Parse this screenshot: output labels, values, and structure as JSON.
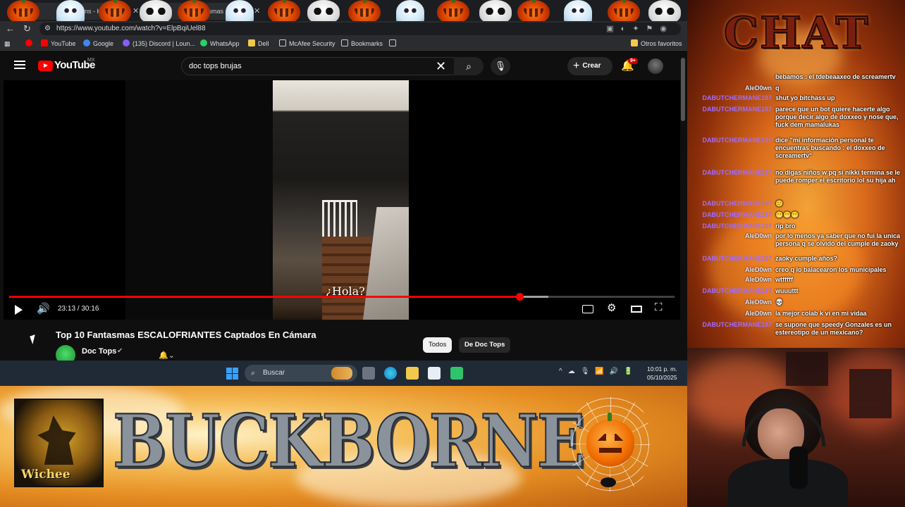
{
  "browser": {
    "tabs": [
      {
        "title": "(103) Ins - KB - M"
      },
      {
        "title": "(10) Fantasmas"
      }
    ],
    "url": "https://www.youtube.com/watch?v=ElpBqiUel88",
    "bookmarks": [
      {
        "label": "YouTube",
        "color": "#ff0000"
      },
      {
        "label": "Google",
        "color": "#4285f4"
      },
      {
        "label": "(135) Discord | Loun...",
        "color": "#8a5cff"
      },
      {
        "label": "WhatsApp",
        "color": "#25d366"
      },
      {
        "label": "Dell",
        "color": "#f2c94c"
      },
      {
        "label": "McAfee Security",
        "color": "#cccccc"
      },
      {
        "label": "Bookmarks",
        "color": "#cccccc"
      }
    ],
    "other_bookmarks": "Otros favoritos"
  },
  "youtube": {
    "logo": "YouTube",
    "country": "MX",
    "search_query": "doc tops brujas",
    "create_label": "Crear",
    "notifications_badge": "9+",
    "player": {
      "subtitle": "¿Hola?",
      "time": "23:13 / 30:16",
      "progress": 0.767,
      "buffered": 0.81,
      "accent": "#ff0000"
    },
    "video_title": "Top 10 Fantasmas ESCALOFRIANTES Captados En Cámara",
    "channel": "Doc Tops",
    "chips": [
      "Todos",
      "De Doc Tops"
    ]
  },
  "taskbar": {
    "search_placeholder": "Buscar",
    "clock_time": "10:01 p. m.",
    "clock_date": "05/10/2025"
  },
  "overlay": {
    "banner_title": "BUCKBORNE",
    "witch_label": "Wichee",
    "chat_title": "CHAT"
  },
  "chat": {
    "messages": [
      {
        "user": "",
        "text": "bebamos : el tdebeaaxeo de screamertv",
        "kind": "dab"
      },
      {
        "user": "AleD0wn",
        "text": "q",
        "kind": "ale"
      },
      {
        "user": "DABUTCHERMANE187",
        "text": "shut yo bitchass up",
        "kind": "dab"
      },
      {
        "user": "DABUTCHERMANE187",
        "text": "parece que un bot quiere hacerte algo porque decir algo de doxxeo y nose que, fuck dem mamalukas",
        "kind": "dab"
      },
      {
        "user": "DABUTCHERMANE187",
        "text": "dice \"mi información personal te encuentras buscando : el doxxeo de screamertv\"",
        "kind": "dab"
      },
      {
        "user": "DABUTCHERMANE187",
        "text": "no digas niños w pq si nikki termina se le puede romper el escritorio lol su hija ah",
        "kind": "dab"
      },
      {
        "user": "DABUTCHERMANE187",
        "text": "🙂",
        "kind": "dab"
      },
      {
        "user": "DABUTCHERMANE187",
        "text": "😬😬😬",
        "kind": "dab"
      },
      {
        "user": "DABUTCHERMANE187",
        "text": "rip bro",
        "kind": "dab"
      },
      {
        "user": "AleD0wn",
        "text": "por lo menos ya saber que no fui la unica persona q se olvidó del cumple de zaoky",
        "kind": "ale"
      },
      {
        "user": "DABUTCHERMANE187",
        "text": "zaoky cumple años?",
        "kind": "dab"
      },
      {
        "user": "AleD0wn",
        "text": "creo q lo balacearon los municipales",
        "kind": "ale"
      },
      {
        "user": "AleD0wn",
        "text": "wtfffff",
        "kind": "ale"
      },
      {
        "user": "DABUTCHERMANE187",
        "text": "wuuuttt",
        "kind": "dab"
      },
      {
        "user": "AleD0wn",
        "text": "💀",
        "kind": "ale"
      },
      {
        "user": "AleD0wn",
        "text": "la mejor colab k vi en mi vidaa",
        "kind": "ale"
      },
      {
        "user": "DABUTCHERMANE187",
        "text": "se supone que speedy Gonzales es un estereotipo de un mexicano?",
        "kind": "dab"
      }
    ]
  }
}
